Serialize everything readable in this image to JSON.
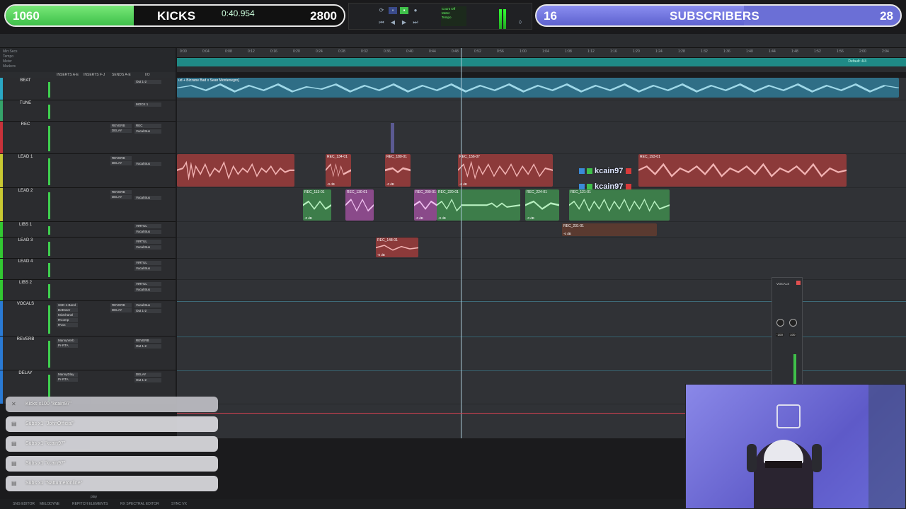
{
  "stream_bar": {
    "kicks_count": "1060",
    "kicks_label": "KICKS",
    "kicks_goal": "2800",
    "kicks_progress": 0.378,
    "subs_count": "16",
    "subs_label": "SUBSCRIBERS",
    "subs_goal": "28",
    "subs_progress": 0.571,
    "transport_counter": "0:40.954",
    "colors": {
      "kicks_fill": "#3fc04a",
      "subs_fill": "#5e62cf"
    }
  },
  "session": {
    "left_rows": [
      "Min:Secs",
      "Tempo",
      "Meter",
      "Markers"
    ],
    "column_headers": [
      "INSERTS A-E",
      "INSERTS F-J",
      "SENDS A-E",
      "I/O"
    ],
    "marker_label": "Default: 4/4",
    "ruler_ticks": [
      "0:00",
      "0:04",
      "0:08",
      "0:12",
      "0:16",
      "0:20",
      "0:24",
      "0:28",
      "0:32",
      "0:36",
      "0:40",
      "0:44",
      "0:48",
      "0:52",
      "0:56",
      "1:00",
      "1:04",
      "1:08",
      "1:12",
      "1:16",
      "1:20",
      "1:24",
      "1:28",
      "1:32",
      "1:36",
      "1:40",
      "1:44",
      "1:48",
      "1:52",
      "1:56",
      "2:00",
      "2:04"
    ]
  },
  "tracks": [
    {
      "name": "BEAT",
      "inserts": [],
      "sends": [],
      "io_in": "Out 1-2",
      "io_out": "",
      "color": "#2aa7c4"
    },
    {
      "name": "TUNE",
      "inserts": [],
      "sends": [],
      "io_in": "MOCK 1",
      "io_out": "",
      "color": "#35a36a"
    },
    {
      "name": "REC",
      "inserts": [],
      "sends": [
        "REVERB",
        "DELAY"
      ],
      "io_in": "REC",
      "io_out": "Vocal Bus",
      "color": "#c8323a"
    },
    {
      "name": "LEAD 1",
      "inserts": [],
      "sends": [
        "REVERB",
        "DELAY"
      ],
      "io_in": "",
      "io_out": "Vocal Bus",
      "color": "#c8c832"
    },
    {
      "name": "LEAD 2",
      "inserts": [],
      "sends": [
        "REVERB",
        "DELAY"
      ],
      "io_in": "",
      "io_out": "Vocal Bus",
      "color": "#c8c832"
    },
    {
      "name": "LIBS 1",
      "inserts": [],
      "sends": [],
      "io_in": "VIRTUL",
      "io_out": "Vocal Bus",
      "color": "#32c832"
    },
    {
      "name": "LEAD 3",
      "inserts": [],
      "sends": [],
      "io_in": "VIRTUL",
      "io_out": "Vocal Bus",
      "color": "#32c832"
    },
    {
      "name": "LEAD 4",
      "inserts": [],
      "sends": [],
      "io_in": "VIRTUL",
      "io_out": "Vocal Bus",
      "color": "#32c832"
    },
    {
      "name": "LIBS 2",
      "inserts": [],
      "sends": [],
      "io_in": "VIRTUL",
      "io_out": "Vocal Bus",
      "color": "#32c832"
    },
    {
      "name": "VOCALS",
      "inserts": [
        "SSD 1-Band",
        "DeEsser",
        "MixChanel",
        "RComp",
        "RVox"
      ],
      "sends": [
        "REVERB",
        "DELAY"
      ],
      "io_in": "Vocal Bus",
      "io_out": "Out 1-2",
      "color": "#2a7ad4"
    },
    {
      "name": "REVERB",
      "inserts": [
        "MannyVerb",
        "Pr-RTA"
      ],
      "sends": [],
      "io_in": "REVERB",
      "io_out": "Out 1-2",
      "color": "#2a7ad4"
    },
    {
      "name": "DELAY",
      "inserts": [
        "MannyDlay",
        "Pr-RTA"
      ],
      "sends": [],
      "io_in": "DELAY",
      "io_out": "Out 1-2",
      "color": "#2a7ad4"
    }
  ],
  "clips": {
    "beat": "ud + Bizzane Bad x Sean Montenegro]",
    "lead1": [
      "REC_134-01",
      "REC_180-01",
      "REC_156-07",
      "REC_193-01"
    ],
    "lead2": [
      "REC_113-01",
      "REC_130-01",
      "REC_200-01",
      "REC_220-01",
      "REC_224-01",
      "REC_121-01"
    ],
    "libs1": [
      "REC_231-01"
    ],
    "lead3": [
      "REC_148-01"
    ],
    "gain_default": "-0 dB"
  },
  "collaborators": [
    "kcain97",
    "kcain97"
  ],
  "mini_mixer": {
    "title": "VOCALS",
    "values": [
      "-100",
      "100"
    ]
  },
  "alerts": [
    {
      "text": "Kicks x100 \"kcain97\""
    },
    {
      "text": "Subs x1 \"JohnOfficial\""
    },
    {
      "text": "Subs x1 \"kcain97\""
    },
    {
      "text": "Subs x1 \"kcain97\""
    },
    {
      "text": "Subs x1 \"Natturneronline\""
    }
  ],
  "bottom_bar": [
    "SNG EDITOR",
    "MELODYNE",
    "REPITCH ELEMENTS",
    "RX SPECTRAL EDITOR",
    "SYNC VX"
  ],
  "bottom_play_label": "play"
}
